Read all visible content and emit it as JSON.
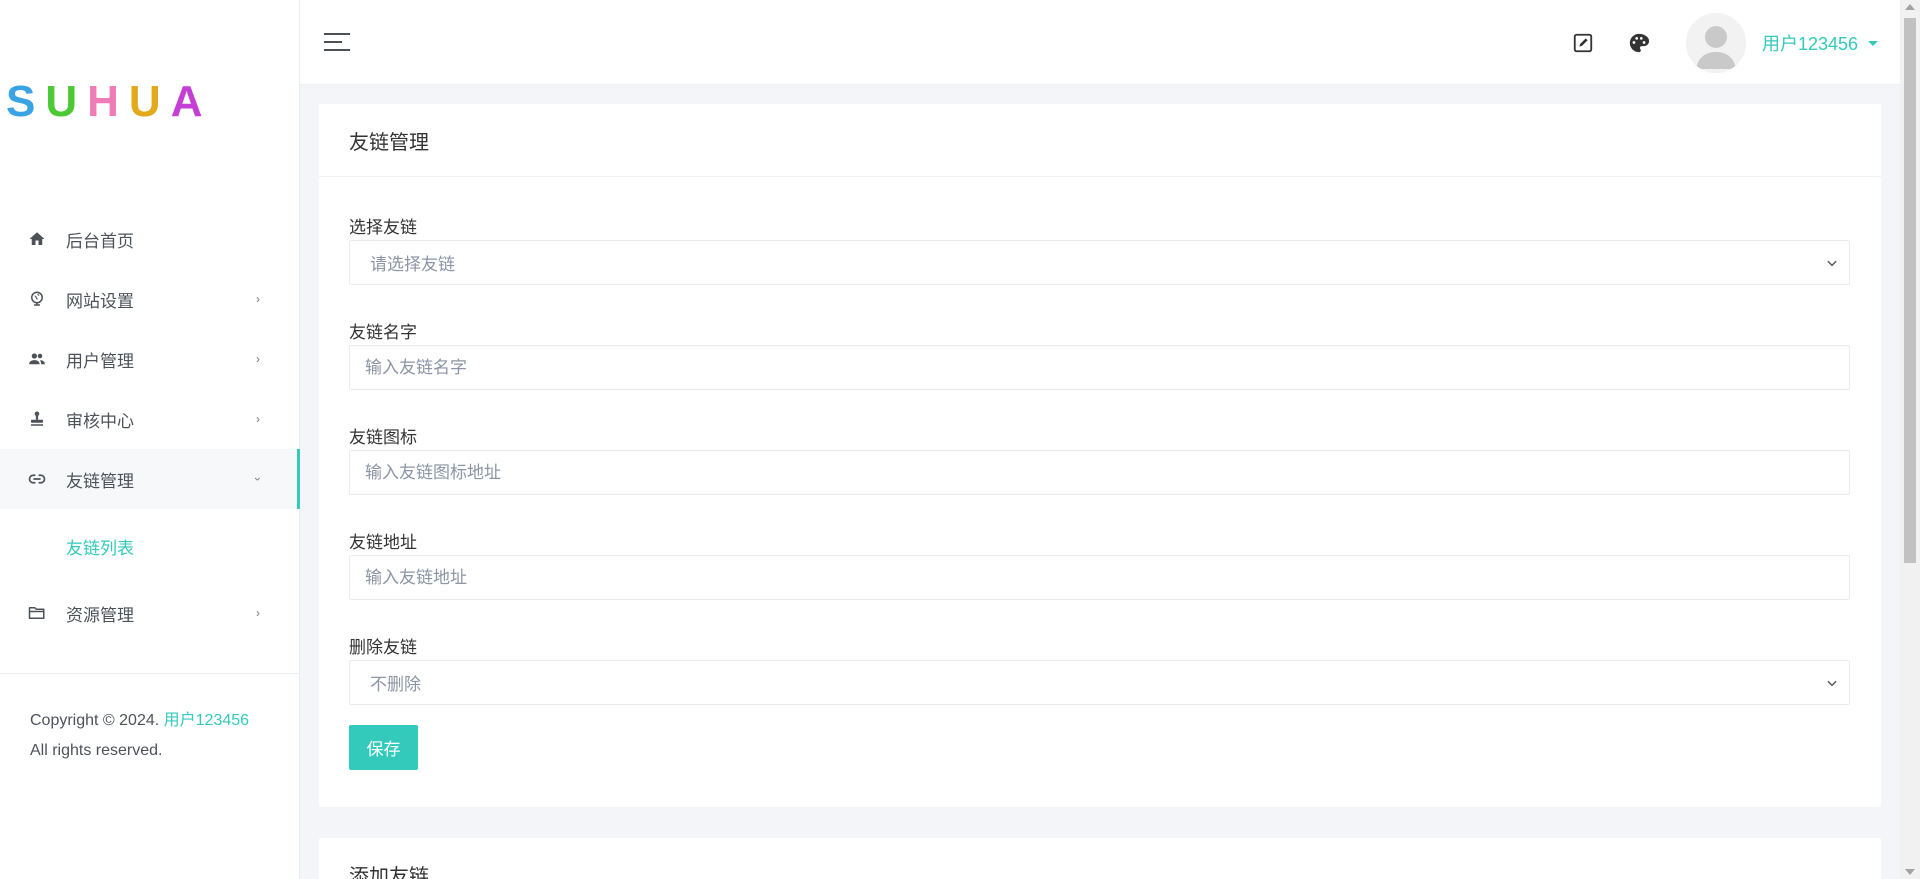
{
  "brand": {
    "logo_letters": [
      {
        "char": "S",
        "color": "#3aa3e3"
      },
      {
        "char": "U",
        "color": "#4cc934"
      },
      {
        "char": "H",
        "color": "#f07cb7"
      },
      {
        "char": "U",
        "color": "#e4a91a"
      },
      {
        "char": "A",
        "color": "#c53fd6"
      }
    ]
  },
  "sidebar": {
    "items": [
      {
        "label": "后台首页",
        "icon": "home-icon"
      },
      {
        "label": "网站设置",
        "icon": "globe-icon"
      },
      {
        "label": "用户管理",
        "icon": "users-icon"
      },
      {
        "label": "审核中心",
        "icon": "stamp-icon"
      },
      {
        "label": "友链管理",
        "icon": "link-icon"
      },
      {
        "label": "资源管理",
        "icon": "folder-icon"
      }
    ],
    "sub_item": "友链列表",
    "copyright_prefix": "Copyright © 2024.",
    "copyright_user": "用户123456",
    "copyright_suffix": "All rights reserved."
  },
  "topbar": {
    "username": "用户123456"
  },
  "colors": {
    "accent": "#33cabb",
    "text": "#4d5259"
  },
  "card": {
    "title": "友链管理",
    "fields": [
      {
        "label": "选择友链",
        "type": "select",
        "value": "请选择友链"
      },
      {
        "label": "友链名字",
        "type": "input",
        "placeholder": "输入友链名字"
      },
      {
        "label": "友链图标",
        "type": "input",
        "placeholder": "输入友链图标地址"
      },
      {
        "label": "友链地址",
        "type": "input",
        "placeholder": "输入友链地址"
      },
      {
        "label": "删除友链",
        "type": "select",
        "value": "不删除"
      }
    ],
    "save_label": "保存"
  },
  "card2": {
    "title": "添加友链"
  }
}
